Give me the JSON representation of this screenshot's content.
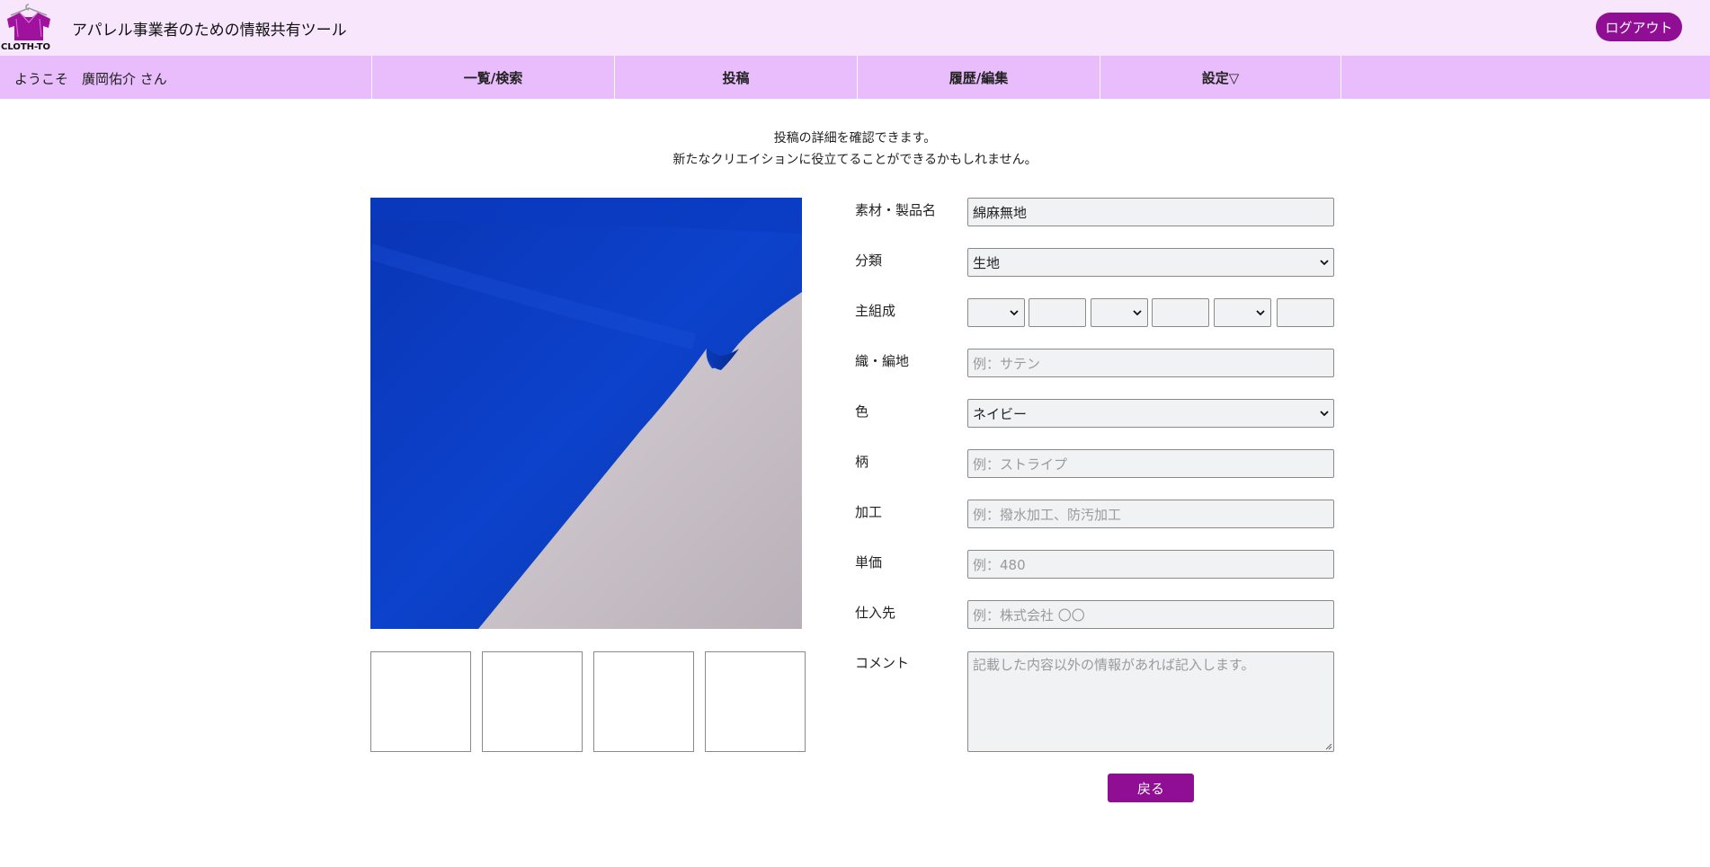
{
  "header": {
    "logo_text": "CLOTH-TO",
    "title": "アパレル事業者のための情報共有ツール",
    "logout_label": "ログアウト"
  },
  "nav": {
    "welcome": "ようこそ　廣岡佑介 さん",
    "items": [
      {
        "label": "一覧/検索"
      },
      {
        "label": "投稿"
      },
      {
        "label": "履歴/編集"
      },
      {
        "label": "設定▽"
      }
    ]
  },
  "intro": {
    "line1": "投稿の詳細を確認できます。",
    "line2": "新たなクリエイションに役立てることができるかもしれません。"
  },
  "form": {
    "product_name": {
      "label": "素材・製品名",
      "value": "綿麻無地"
    },
    "category": {
      "label": "分類",
      "value": "生地"
    },
    "composition": {
      "label": "主組成"
    },
    "weave": {
      "label": "織・編地",
      "placeholder": "例：サテン"
    },
    "color": {
      "label": "色",
      "value": "ネイビー"
    },
    "pattern": {
      "label": "柄",
      "placeholder": "例：ストライプ"
    },
    "processing": {
      "label": "加工",
      "placeholder": "例：撥水加工、防汚加工"
    },
    "unit_price": {
      "label": "単価",
      "placeholder": "例：480"
    },
    "supplier": {
      "label": "仕入先",
      "placeholder": "例：株式会社 〇〇"
    },
    "comment": {
      "label": "コメント",
      "placeholder": "記載した内容以外の情報があれば記入します。"
    }
  },
  "back_label": "戻る",
  "colors": {
    "header_bg": "#f7e6fc",
    "nav_bg": "#e9bcfb",
    "accent": "#8f0e94",
    "fabric_blue": "#0b3fc2"
  },
  "icons": {
    "logo": "hanger-shirt-icon",
    "dropdown": "chevron-down-icon"
  }
}
